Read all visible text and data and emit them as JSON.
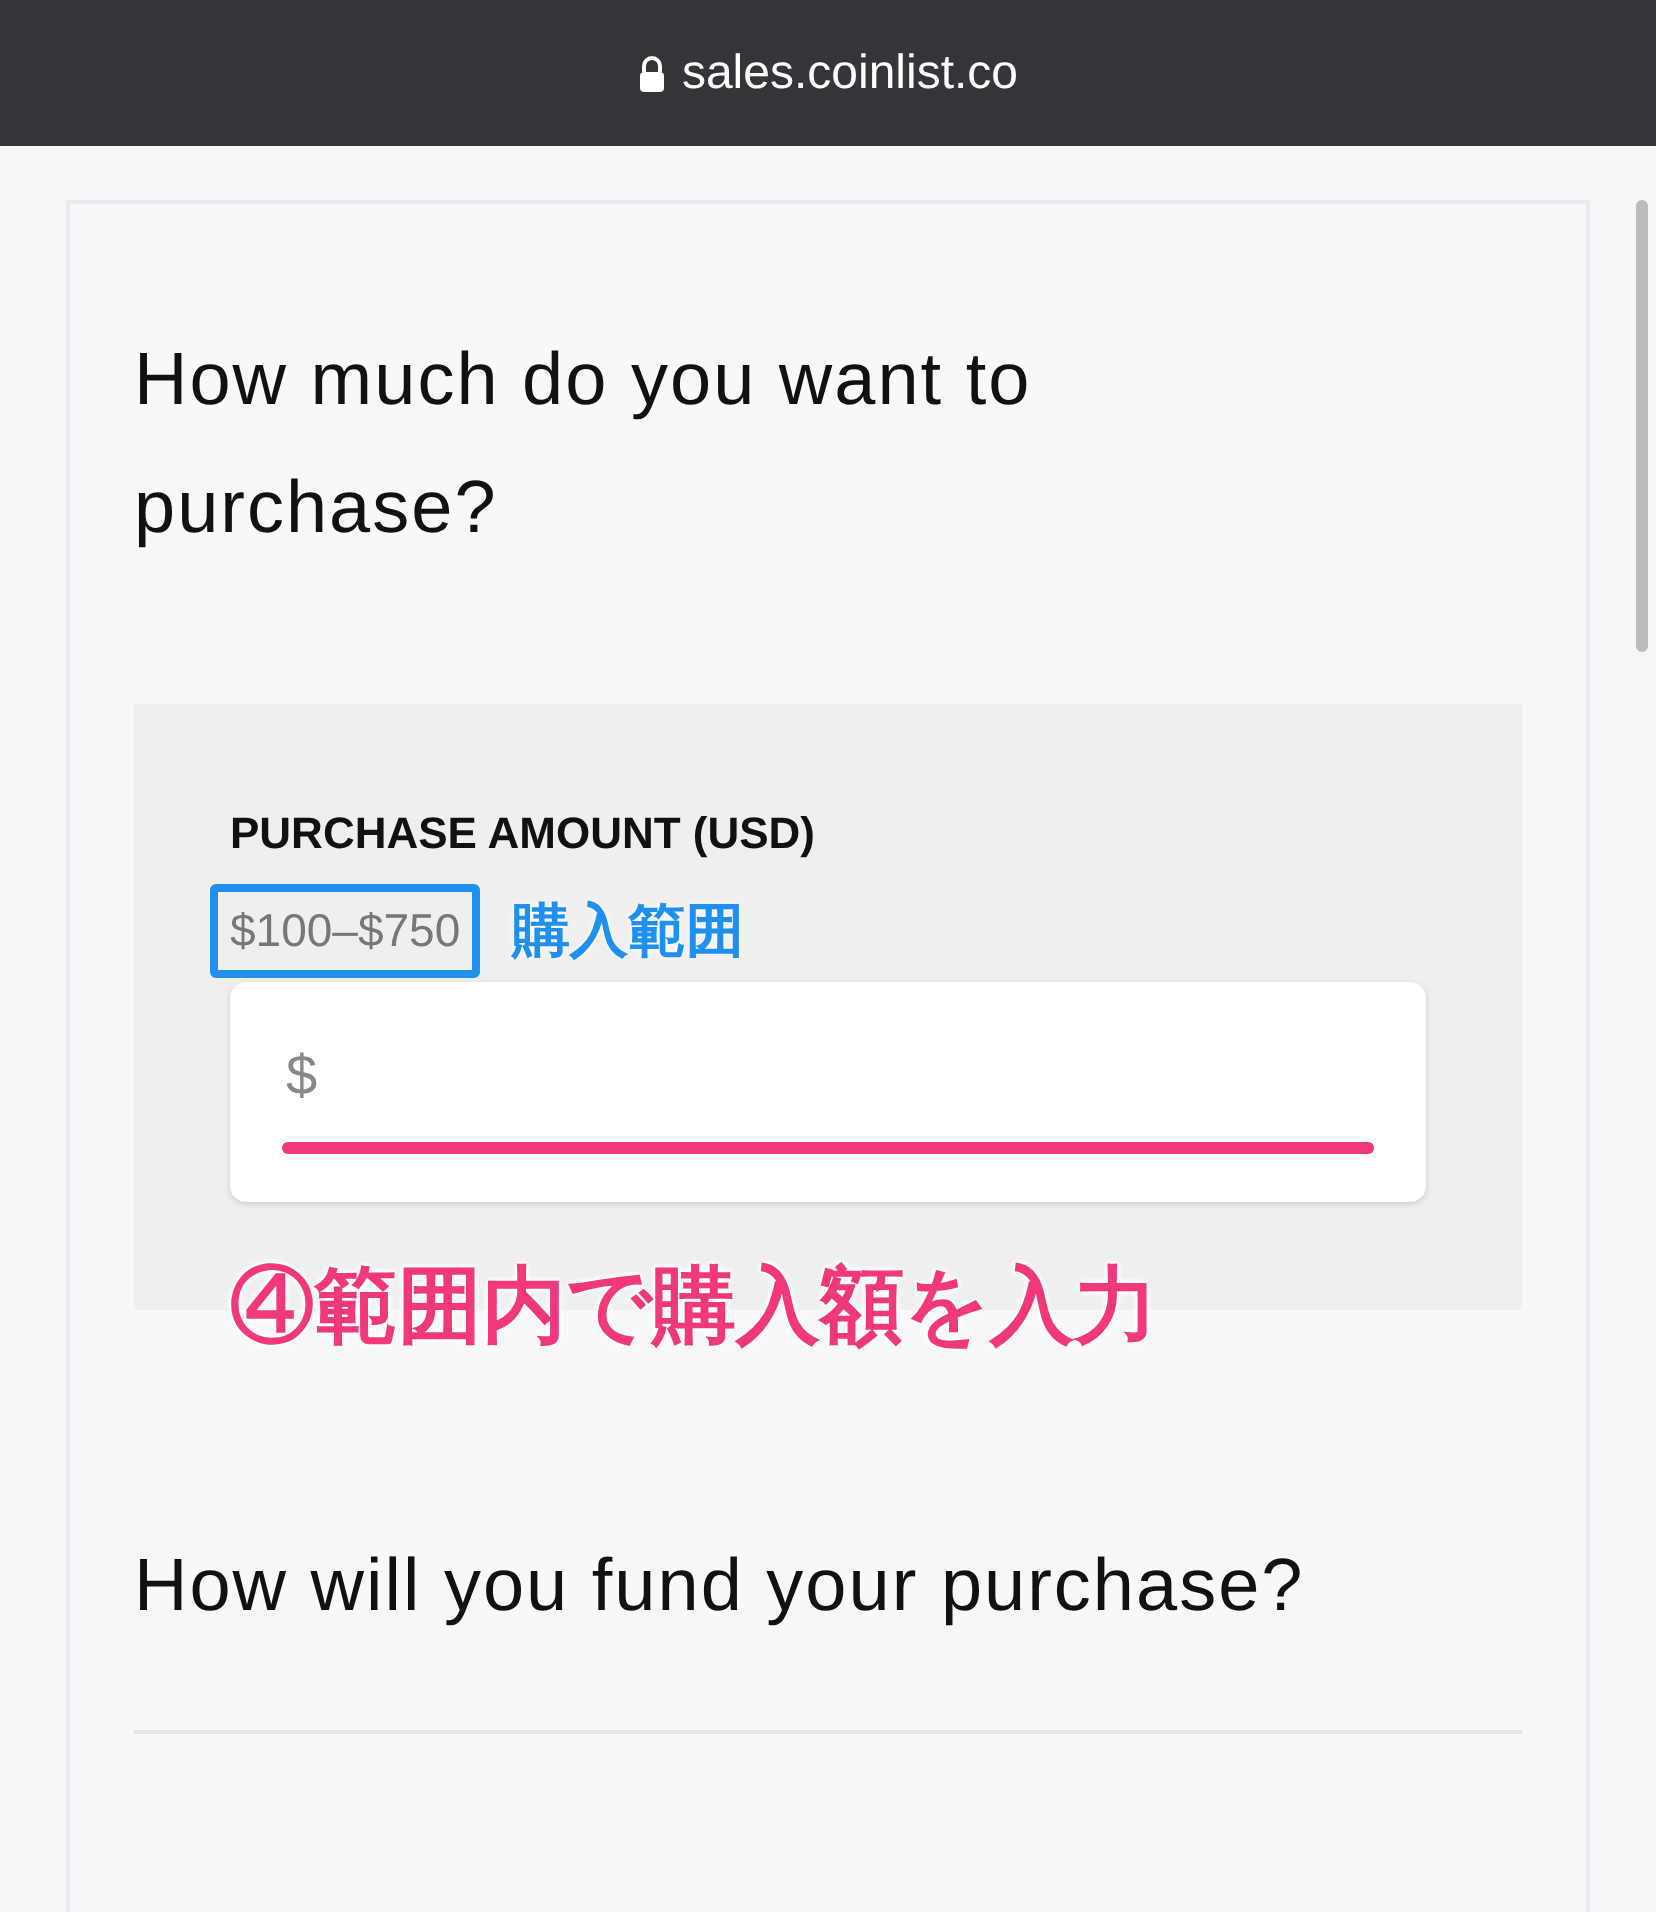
{
  "address_bar": {
    "url": "sales.coinlist.co"
  },
  "question_1": "How much do you want to purchase?",
  "amount_section": {
    "label": "PURCHASE AMOUNT (USD)",
    "range": "$100–$750",
    "placeholder": "$"
  },
  "annotations": {
    "range_note": "購入範囲",
    "instruction": "④範囲内で購入額を入力"
  },
  "question_2": "How will you fund your purchase?"
}
